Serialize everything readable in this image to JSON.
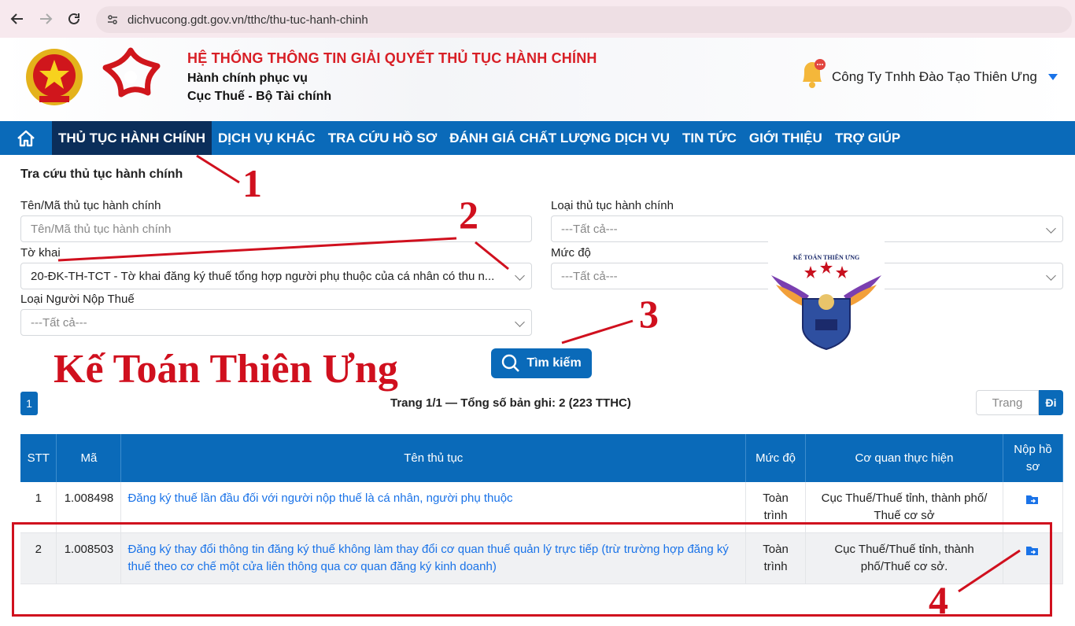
{
  "browser": {
    "url": "dichvucong.gdt.gov.vn/tthc/thu-tuc-hanh-chinh"
  },
  "header": {
    "title": "HỆ THỐNG THÔNG TIN GIẢI QUYẾT THỦ TỤC HÀNH CHÍNH",
    "subtitle1": "Hành chính phục vụ",
    "subtitle2": "Cục Thuế - Bộ Tài chính",
    "company": "Công Ty Tnhh Đào Tạo Thiên Ưng"
  },
  "nav": {
    "items": [
      {
        "label": "THỦ TỤC HÀNH CHÍNH"
      },
      {
        "label": "DỊCH VỤ KHÁC"
      },
      {
        "label": "TRA CỨU HỒ SƠ"
      },
      {
        "label": "ĐÁNH GIÁ CHẤT LƯỢNG DỊCH VỤ"
      },
      {
        "label": "TIN TỨC"
      },
      {
        "label": "GIỚI THIỆU"
      },
      {
        "label": "TRỢ GIÚP"
      }
    ]
  },
  "search": {
    "section_title": "Tra cứu thủ tục hành chính",
    "name_label": "Tên/Mã thủ tục hành chính",
    "name_placeholder": "Tên/Mã thủ tục hành chính",
    "type_label": "Loại thủ tục hành chính",
    "type_value": "---Tất cả---",
    "form_label": "Tờ khai",
    "form_value": "20-ĐK-TH-TCT - Tờ khai đăng ký thuế tổng hợp người phụ thuộc của cá nhân có thu n...",
    "level_label": "Mức độ",
    "level_value": "---Tất cả---",
    "taxpayer_label": "Loại Người Nộp Thuế",
    "taxpayer_value": "---Tất cả---",
    "button_label": "Tìm kiếm"
  },
  "pagination": {
    "current_page": "1",
    "info": "Trang 1/1 — Tổng số bản ghi: 2 (223 TTHC)",
    "page_placeholder": "Trang",
    "go_label": "Đi"
  },
  "table": {
    "headers": [
      "STT",
      "Mã",
      "Tên thủ tục",
      "Mức độ",
      "Cơ quan thực hiện",
      "Nộp hồ sơ"
    ],
    "rows": [
      {
        "stt": "1",
        "code": "1.008498",
        "name": "Đăng ký thuế lần đầu đối với người nộp thuế là cá nhân, người phụ thuộc",
        "level": "Toàn trình",
        "agency": "Cục Thuế/Thuế tỉnh, thành phố/ Thuế cơ sở"
      },
      {
        "stt": "2",
        "code": "1.008503",
        "name": "Đăng ký thay đổi thông tin đăng ký thuế không làm thay đổi cơ quan thuế quản lý trực tiếp (trừ trường hợp đăng ký thuế theo cơ chế một cửa liên thông qua cơ quan đăng ký kinh doanh)",
        "level": "Toàn trình",
        "agency": "Cục Thuế/Thuế tỉnh, thành phố/Thuế cơ sở."
      }
    ]
  },
  "annotations": {
    "n1": "1",
    "n2": "2",
    "n3": "3",
    "n4": "4",
    "watermark": "Kế Toán Thiên Ưng",
    "logo_text": "KẾ TOÁN THIÊN ƯNG"
  },
  "colors": {
    "primary": "#0a6ab9",
    "nav_active": "#0b2e5a",
    "title_red": "#d81f26",
    "annotation_red": "#d0101e",
    "link": "#1a73e8"
  }
}
